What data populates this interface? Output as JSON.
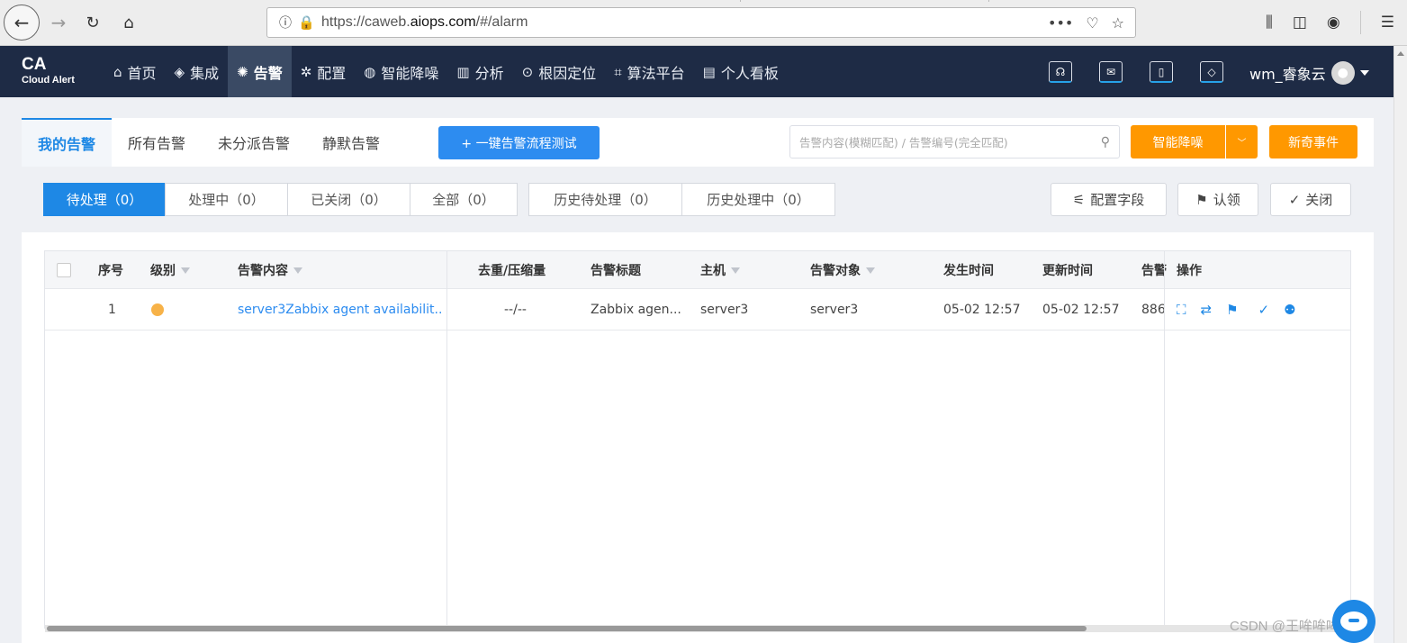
{
  "browser": {
    "url_prefix": "https://caweb.",
    "url_domain": "aiops.com",
    "url_suffix": "/#/alarm",
    "more_label": "•••"
  },
  "app": {
    "logo_main": "CA",
    "logo_sub": "Cloud Alert",
    "menu": [
      {
        "label": "首页",
        "icon": "home-icon",
        "glyph": "⌂"
      },
      {
        "label": "集成",
        "icon": "layers-icon",
        "glyph": "◈"
      },
      {
        "label": "告警",
        "icon": "alarm-icon",
        "glyph": "✺"
      },
      {
        "label": "配置",
        "icon": "gear-icon",
        "glyph": "✲"
      },
      {
        "label": "智能降噪",
        "icon": "noise-icon",
        "glyph": "◍"
      },
      {
        "label": "分析",
        "icon": "chart-icon",
        "glyph": "▥"
      },
      {
        "label": "根因定位",
        "icon": "target-icon",
        "glyph": "⊙"
      },
      {
        "label": "算法平台",
        "icon": "algo-icon",
        "glyph": "⌗"
      },
      {
        "label": "个人看板",
        "icon": "dashboard-icon",
        "glyph": "▤"
      }
    ],
    "active_menu": "告警",
    "user_name": "wm_睿象云",
    "accent": "#1e88e5",
    "header_bg": "#1e2b45"
  },
  "tabs": [
    "我的告警",
    "所有告警",
    "未分派告警",
    "静默告警"
  ],
  "test_button": "+ 一键告警流程测试",
  "search_placeholder": "告警内容(模糊匹配) / 告警编号(完全匹配)",
  "smart_button": "智能降噪",
  "new_event_button": "新奇事件",
  "status_tabs": [
    "待处理（0）",
    "处理中（0）",
    "已关闭（0）",
    "全部（0）",
    "历史待处理（0）",
    "历史处理中（0）"
  ],
  "tools": {
    "config_fields": "配置字段",
    "claim": "认领",
    "close": "关闭"
  },
  "table": {
    "headers": {
      "seq": "序号",
      "level": "级别",
      "content": "告警内容",
      "dedupe": "去重/压缩量",
      "title": "告警标题",
      "host": "主机",
      "target": "告警对象",
      "occur": "发生时间",
      "update": "更新时间",
      "alarm_id": "告警",
      "ops": "操作"
    },
    "rows": [
      {
        "seq": "1",
        "level_color": "#f7b248",
        "content": "server3Zabbix agent availabilit...",
        "dedupe": "--/--",
        "title": "Zabbix agen...",
        "host": "server3",
        "target": "server3",
        "occur": "05-02 12:57",
        "update": "05-02 12:57",
        "alarm_id": "886"
      }
    ]
  },
  "watermark": "CSDN @王哞哞哞哞"
}
